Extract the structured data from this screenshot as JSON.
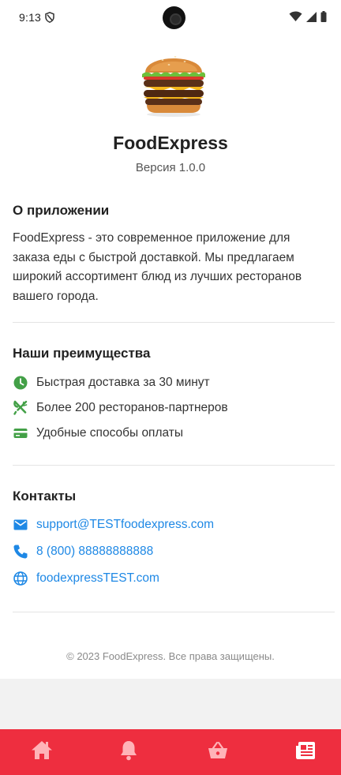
{
  "status_bar": {
    "time": "9:13",
    "icons": [
      "shield-icon",
      "wifi-icon",
      "signal-icon",
      "battery-icon"
    ]
  },
  "app": {
    "logo": "burger-logo",
    "name": "FoodExpress",
    "version": "Версия 1.0.0"
  },
  "about": {
    "title": "О приложении",
    "text": "FoodExpress - это современное приложение для заказа еды с быстрой доставкой. Мы предлагаем широкий ассортимент блюд из лучших ресторанов вашего города."
  },
  "advantages": {
    "title": "Наши преимущества",
    "items": [
      {
        "icon": "clock-icon",
        "label": "Быстрая доставка за 30 минут"
      },
      {
        "icon": "utensils-icon",
        "label": "Более 200 ресторанов-партнеров"
      },
      {
        "icon": "credit-card-icon",
        "label": "Удобные способы оплаты"
      }
    ]
  },
  "contacts": {
    "title": "Контакты",
    "email": "support@TESTfoodexpress.com",
    "phone": "8 (800) 88888888888",
    "website": "foodexpressTEST.com"
  },
  "footer": {
    "copyright": "© 2023 FoodExpress. Все права защищены."
  },
  "bottom_nav": {
    "items": [
      "home-icon",
      "bell-icon",
      "basket-icon",
      "news-icon"
    ],
    "active": "news-icon"
  },
  "colors": {
    "accent": "#ee2e3f",
    "icon_green": "#43a047",
    "link_blue": "#1e88e5"
  }
}
